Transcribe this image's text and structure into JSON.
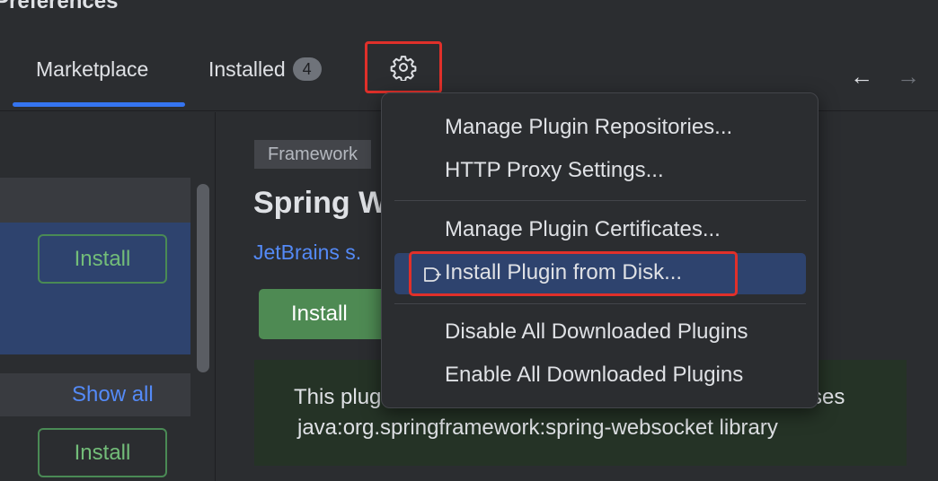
{
  "window": {
    "title": "Preferences"
  },
  "tabs": {
    "marketplace": "Marketplace",
    "installed": "Installed",
    "installed_count": "4"
  },
  "icons": {
    "settings": "gear-icon",
    "back": "arrow-left-icon",
    "forward": "arrow-right-icon",
    "plugin": "plug-icon"
  },
  "nav": {
    "back": "←",
    "forward": "→"
  },
  "list": {
    "install_label_1": "Install",
    "show_all": "Show all",
    "install_label_2": "Install"
  },
  "detail": {
    "tag": "Framework",
    "title": "Spring W",
    "vendor": "JetBrains s.",
    "install_label": "Install",
    "description_line1_start": "This plug",
    "description_line1_end": "ses",
    "description_line2": "java:org.springframework:spring-websocket library"
  },
  "menu": {
    "items": [
      "Manage Plugin Repositories...",
      "HTTP Proxy Settings...",
      "Manage Plugin Certificates...",
      "Install Plugin from Disk...",
      "Disable All Downloaded Plugins",
      "Enable All Downloaded Plugins"
    ],
    "highlighted_index": 3
  },
  "colors": {
    "background": "#2b2d30",
    "accent": "#3574f0",
    "highlight": "#e0302a",
    "install_green": "#4e8a53",
    "selection": "#2e436e"
  }
}
